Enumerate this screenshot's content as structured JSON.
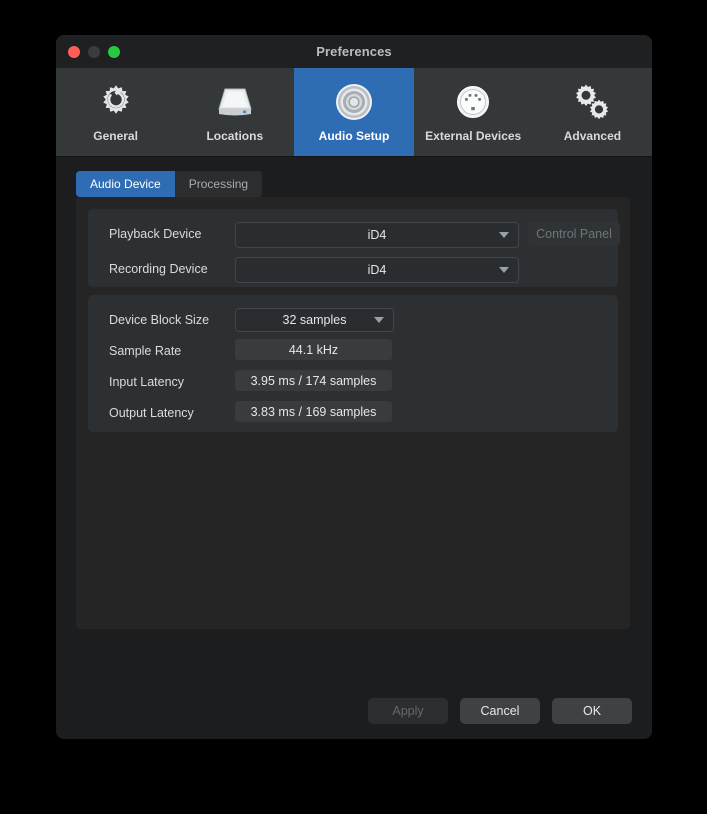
{
  "window": {
    "title": "Preferences",
    "traffic_lights": [
      {
        "name": "close",
        "color": "#ff5f57"
      },
      {
        "name": "minimize",
        "color": "#3a3d3f"
      },
      {
        "name": "zoom",
        "color": "#28c840"
      }
    ]
  },
  "colors": {
    "accent": "#2e6db4",
    "toolbar_bg": "#343838",
    "content_bg": "#1b1d1e",
    "panel_bg": "#252525",
    "group_bg": "#2d3033",
    "field_bg": "#393c3f",
    "dropdown_bg": "#2a2d2f"
  },
  "toolbar": {
    "items": [
      {
        "label": "General",
        "icon": "gear-refresh-icon",
        "active": false
      },
      {
        "label": "Locations",
        "icon": "hard-drive-icon",
        "active": false
      },
      {
        "label": "Audio Setup",
        "icon": "speaker-icon",
        "active": true
      },
      {
        "label": "External Devices",
        "icon": "midi-port-icon",
        "active": false
      },
      {
        "label": "Advanced",
        "icon": "double-gear-icon",
        "active": false
      }
    ]
  },
  "tabs": [
    {
      "label": "Audio Device",
      "active": true
    },
    {
      "label": "Processing",
      "active": false
    }
  ],
  "device_group": {
    "playback": {
      "label": "Playback Device",
      "value": "iD4"
    },
    "recording": {
      "label": "Recording Device",
      "value": "iD4"
    },
    "control_panel_button": {
      "label": "Control Panel",
      "enabled": false
    }
  },
  "block_group": {
    "block_size": {
      "label": "Device Block Size",
      "value": "32 samples"
    },
    "sample_rate": {
      "label": "Sample Rate",
      "value": "44.1 kHz"
    },
    "input_latency": {
      "label": "Input Latency",
      "value": "3.95 ms / 174 samples"
    },
    "output_latency": {
      "label": "Output Latency",
      "value": "3.83 ms / 169 samples"
    }
  },
  "footer": {
    "apply": "Apply",
    "cancel": "Cancel",
    "ok": "OK"
  }
}
